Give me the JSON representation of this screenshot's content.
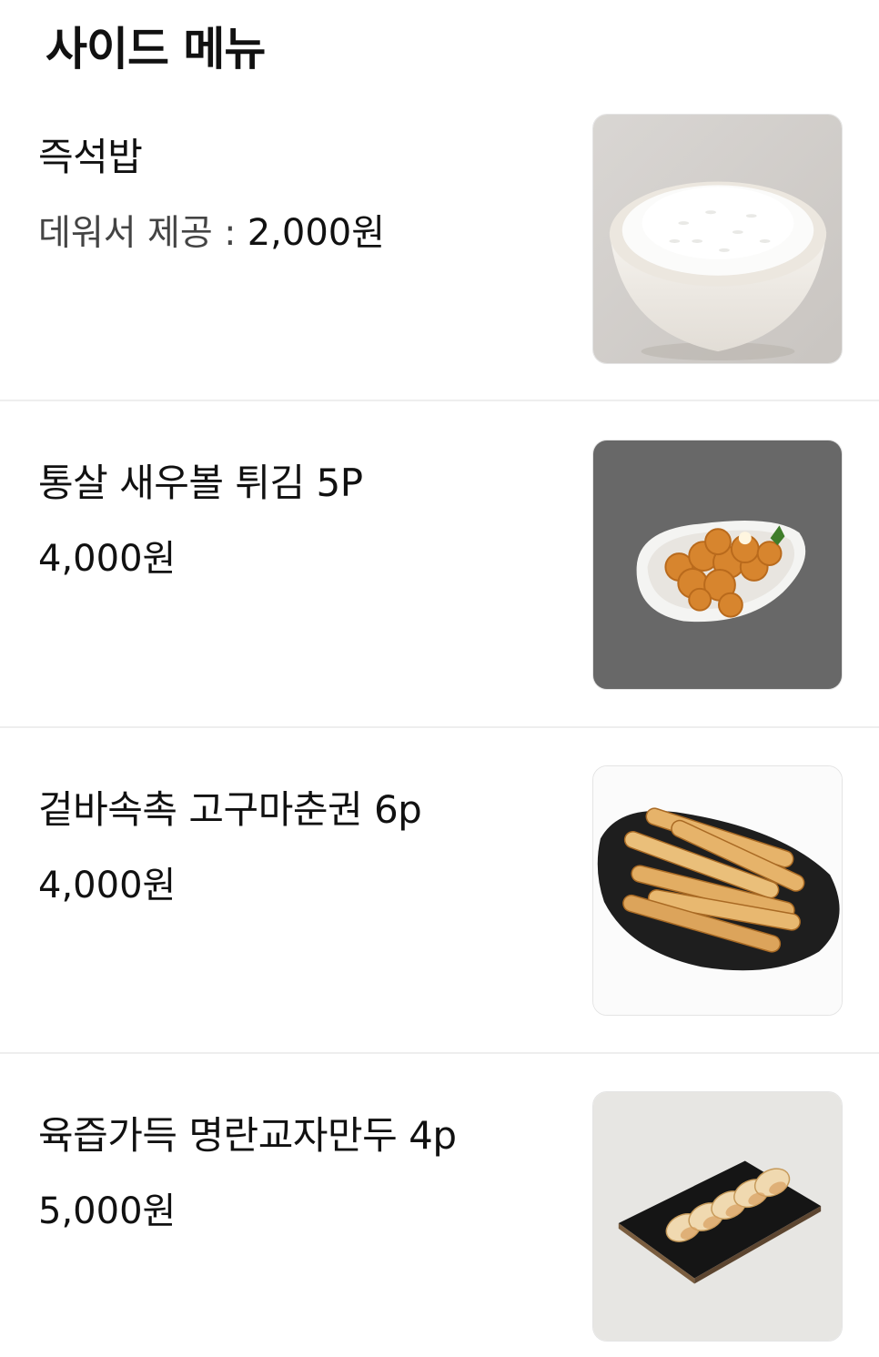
{
  "section": {
    "title": "사이드 메뉴"
  },
  "items": [
    {
      "name": "즉석밥",
      "price_prefix": "데워서 제공 : ",
      "price": "2,000원",
      "image": "rice-bowl-photo"
    },
    {
      "name": "통살 새우볼 튀김 5P",
      "price_prefix": "",
      "price": "4,000원",
      "image": "fried-shrimp-balls-photo"
    },
    {
      "name": "겉바속촉 고구마춘권 6p",
      "price_prefix": "",
      "price": "4,000원",
      "image": "sweet-potato-spring-rolls-photo"
    },
    {
      "name": "육즙가득 명란교자만두 4p",
      "price_prefix": "",
      "price": "5,000원",
      "image": "pollock-roe-dumplings-photo"
    }
  ]
}
